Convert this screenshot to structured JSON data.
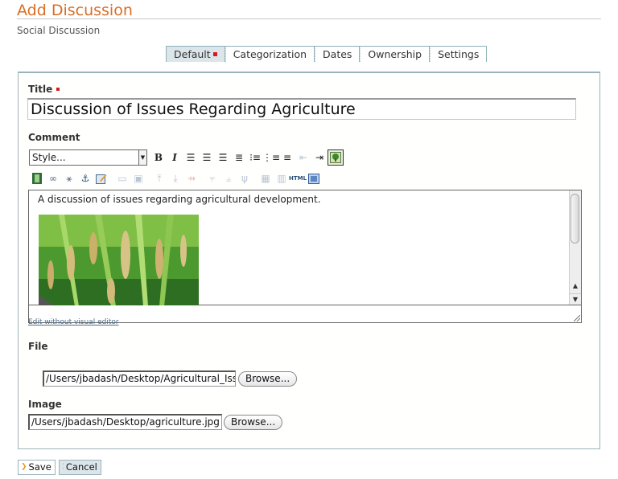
{
  "header": {
    "title": "Add Discussion",
    "subtitle": "Social Discussion"
  },
  "tabs": [
    {
      "label": "Default",
      "active": true,
      "required": true
    },
    {
      "label": "Categorization",
      "active": false
    },
    {
      "label": "Dates",
      "active": false
    },
    {
      "label": "Ownership",
      "active": false
    },
    {
      "label": "Settings",
      "active": false
    }
  ],
  "form": {
    "title_label": "Title",
    "title_value": "Discussion of Issues Regarding Agriculture",
    "comment_label": "Comment",
    "style_select": "Style...",
    "editor_text": "A discussion of issues regarding agricultural development.",
    "editor_image_alt": "rice paddy crop",
    "edit_link": "Edit without visual editor",
    "file_label": "File",
    "file_value": "/Users/jbadash/Desktop/Agricultural_Issues",
    "image_label": "Image",
    "image_value": "/Users/jbadash/Desktop/agriculture.jpg",
    "browse_label": "Browse..."
  },
  "toolbar": {
    "row1": [
      "bold",
      "italic",
      "align-left",
      "align-center",
      "align-right",
      "align-justify",
      "bullet-list",
      "numbered-list",
      "indent-list",
      "outdent",
      "indent",
      "insert-image"
    ],
    "row2": [
      "insert-media",
      "insert-link",
      "unlink",
      "anchor",
      "edit-attributes",
      "table-row-props",
      "table-cell-props",
      "insert-row-before",
      "insert-row-after",
      "delete-row",
      "insert-col-before",
      "insert-col-after",
      "delete-col",
      "insert-table",
      "merge-cells",
      "html-source",
      "fullscreen"
    ]
  },
  "actions": {
    "save_label": "Save",
    "cancel_label": "Cancel"
  },
  "colors": {
    "title": "#d96e26",
    "required": "#d21d1d",
    "active_tab": "#dce6ea",
    "panel_border": "#9db3ba"
  }
}
